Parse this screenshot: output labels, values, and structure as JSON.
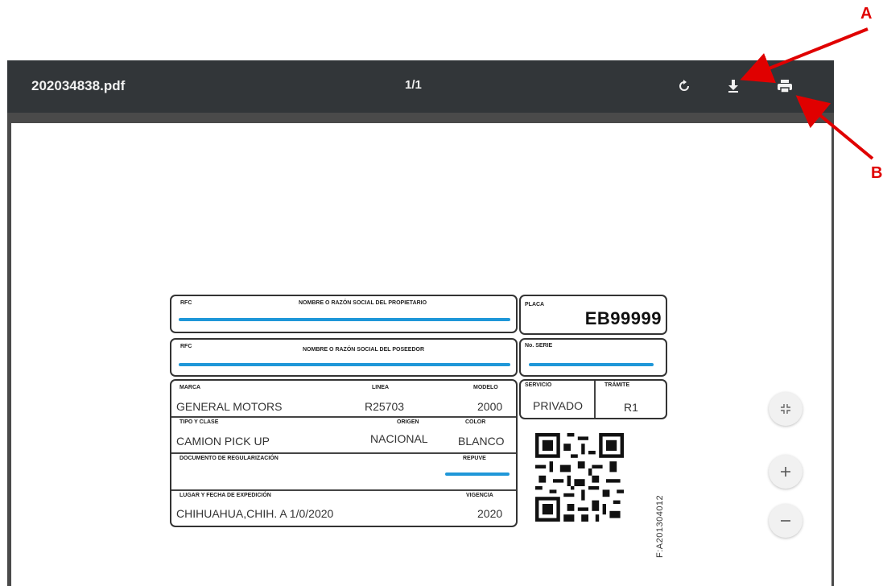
{
  "viewer": {
    "filename": "202034838.pdf",
    "page_indicator": "1/1",
    "icons": {
      "rotate": "rotate-icon",
      "download": "download-icon",
      "print": "print-icon",
      "fit": "fit-page-icon",
      "zoom_in": "zoom-in-icon",
      "zoom_out": "zoom-out-icon"
    }
  },
  "document": {
    "owner": {
      "rfc_label": "RFC",
      "name_label": "NOMBRE O RAZÓN SOCIAL DEL PROPIETARIO"
    },
    "holder": {
      "rfc_label": "RFC",
      "name_label": "NOMBRE O RAZÓN SOCIAL DEL POSEEDOR"
    },
    "plate": {
      "label": "PLACA",
      "value": "EB99999"
    },
    "serial": {
      "label": "No. SERIE"
    },
    "service": {
      "label": "SERVICIO",
      "value": "PRIVADO"
    },
    "procedure": {
      "label": "TRÁMITE",
      "value": "R1"
    },
    "brand": {
      "label": "MARCA",
      "value": "GENERAL MOTORS"
    },
    "line": {
      "label": "LINEA",
      "value": "R25703"
    },
    "model": {
      "label": "MODELO",
      "value": "2000"
    },
    "type": {
      "label": "TIPO Y CLASE",
      "value": "CAMION PICK UP"
    },
    "origin": {
      "label": "ORIGEN",
      "value": "NACIONAL"
    },
    "color": {
      "label": "COLOR",
      "value": "BLANCO"
    },
    "regularization": {
      "label": "DOCUMENTO DE REGULARIZACIÓN"
    },
    "repuve": {
      "label": "REPUVE"
    },
    "place_date": {
      "label": "LUGAR Y FECHA DE EXPEDICIÓN",
      "value": "CHIHUAHUA,CHIH. A 1/0/2020"
    },
    "validity": {
      "label": "VIGENCIA",
      "value": "2020"
    },
    "folio": "F:A201304012"
  },
  "annotations": {
    "a": "A",
    "b": "B",
    "color": "#e00000"
  }
}
